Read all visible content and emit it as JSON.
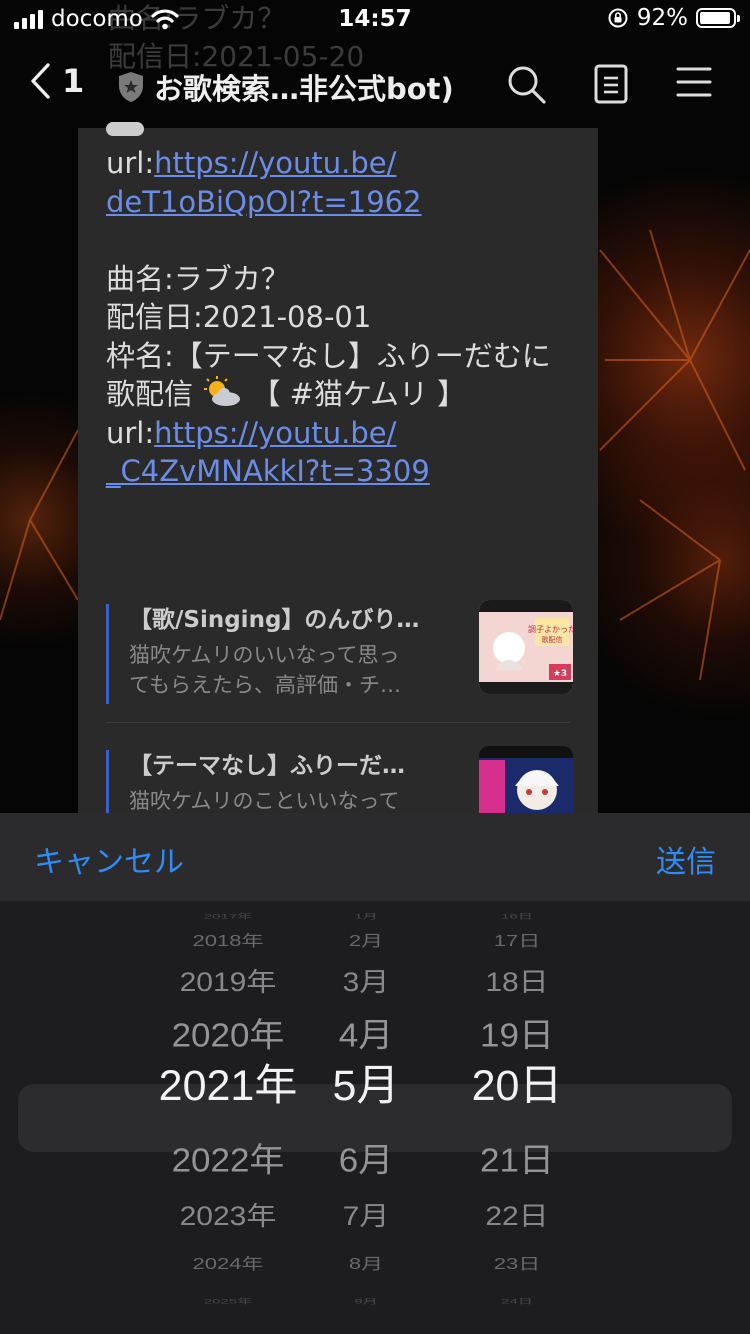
{
  "status_bar": {
    "carrier": "docomo",
    "time": "14:57",
    "battery": "92%",
    "battery_level": 0.92
  },
  "ghost_text": {
    "line1": "曲名:ラブカ？",
    "line2": "配信日:2021-05-20"
  },
  "header": {
    "back_count": "1",
    "title": "お歌検索…非公式bot)"
  },
  "message": {
    "url_label_1": "url:",
    "link_1a": "https://youtu.be/",
    "link_1b": "deT1oBiQpOI?t=1962",
    "song": "曲名:ラブカ？",
    "date": "配信日:2021-08-01",
    "frame_a": "枠名:【テーマなし】ふりーだむに",
    "frame_b1": "歌配信",
    "frame_b2": "【 #猫ケムリ 】",
    "url_label_2": "url:",
    "link_2a": "https://youtu.be/",
    "link_2b": "_C4ZvMNAkkI?t=3309"
  },
  "previews": [
    {
      "title": "【歌/Singing】のんびり…",
      "desc_1": "猫吹ケムリのいいなって思っ",
      "desc_2": "てもらえたら、高評価・チ…",
      "thumb_text_1": "調子よかった",
      "thumb_text_2": "歌配信",
      "thumb_badge": "★3"
    },
    {
      "title": "【テーマなし】ふりーだ…",
      "desc_1": "猫吹ケムリのこといいなって",
      "desc_2": ""
    }
  ],
  "picker_toolbar": {
    "cancel": "キャンセル",
    "send": "送信"
  },
  "picker": {
    "years": [
      "2017年",
      "2018年",
      "2019年",
      "2020年",
      "2021年",
      "2022年",
      "2023年",
      "2024年",
      "2025年"
    ],
    "months": [
      "1月",
      "2月",
      "3月",
      "4月",
      "5月",
      "6月",
      "7月",
      "8月",
      "9月"
    ],
    "days": [
      "16日",
      "17日",
      "18日",
      "19日",
      "20日",
      "21日",
      "22日",
      "23日",
      "24日"
    ],
    "selected": {
      "year": "2021年",
      "month": "5月",
      "day": "20日"
    }
  },
  "colors": {
    "accent": "#2f8cf5",
    "link": "#6b8de8",
    "bubble": "#2a2a2a",
    "sheet": "#1d1d1f"
  }
}
